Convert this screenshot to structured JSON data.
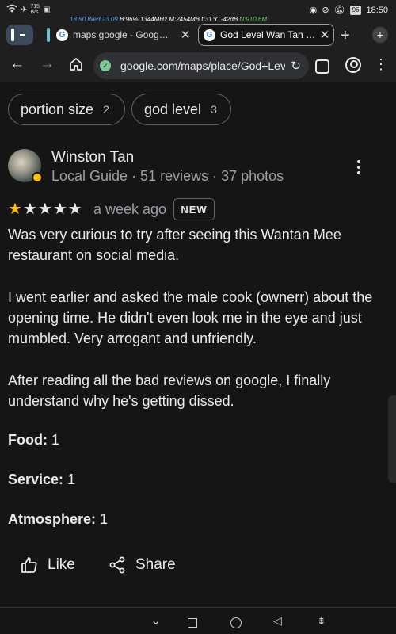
{
  "status_bar": {
    "network_speed": "715\nB/s",
    "time": "18:50",
    "battery": "96",
    "overlay_time": "18:50 Wed 23.09",
    "overlay_b": "B:96%",
    "overlay_mhz": "1344MHz",
    "overlay_mem": "M:2454MB",
    "overlay_temp": "t:31℃",
    "overlay_db": "-42dB",
    "overlay_n": "N:910.6M"
  },
  "tabs": [
    {
      "title": "maps google - Goog…",
      "favicon": "google-g"
    },
    {
      "title": "God Level Wan Tan …",
      "favicon": "google-g"
    }
  ],
  "toolbar": {
    "url": "google.com/maps/place/God+Lev",
    "tab_count": ""
  },
  "chips": [
    {
      "label": "portion size",
      "count": "2"
    },
    {
      "label": "god level",
      "count": "3"
    }
  ],
  "review": {
    "author": "Winston Tan",
    "author_meta": "Local Guide · 51 reviews · 37 photos",
    "rating": 1,
    "max_rating": 5,
    "time_ago": "a week ago",
    "badge": "NEW",
    "paragraphs": [
      "Was very curious to try after seeing this Wantan Mee restaurant on social media.",
      "I went earlier and asked the male cook (ownerr) about the opening time. He didn't even look me in the eye and just mumbled. Very arrogant and unfriendly.",
      "After reading all the bad reviews on google, I finally understand why he's getting dissed."
    ],
    "ratings": [
      {
        "label": "Food:",
        "value": "1"
      },
      {
        "label": "Service:",
        "value": "1"
      },
      {
        "label": "Atmosphere:",
        "value": "1"
      }
    ],
    "actions": {
      "like": "Like",
      "share": "Share"
    }
  },
  "colors": {
    "star_filled": "#fbbc04",
    "background": "#151515",
    "chrome": "#1f1f1f"
  }
}
